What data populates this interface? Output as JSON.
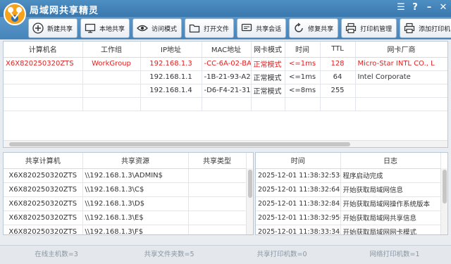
{
  "app": {
    "title": "局域网共享精灵"
  },
  "toolbar": {
    "buttons": [
      {
        "label": "新建共享",
        "icon": "plus-icon"
      },
      {
        "label": "本地共享",
        "icon": "monitor-icon"
      },
      {
        "label": "访问模式",
        "icon": "eye-icon"
      },
      {
        "label": "打开文件",
        "icon": "folder-icon"
      },
      {
        "label": "共享会话",
        "icon": "chat-icon"
      },
      {
        "label": "修复共享",
        "icon": "refresh-icon"
      },
      {
        "label": "打印机管理",
        "icon": "printer-icon"
      },
      {
        "label": "添加打印机",
        "icon": "printer-add-icon"
      }
    ]
  },
  "hosts": {
    "columns": [
      "计算机名",
      "工作组",
      "IP地址",
      "MAC地址",
      "网卡模式",
      "时间",
      "TTL",
      "网卡厂商"
    ],
    "rows": [
      [
        "X6X820250320ZTS",
        "WorkGroup",
        "192.168.1.3",
        "-CC-6A-02-BA",
        "正常模式",
        "<=1ms",
        "128",
        "Micro-Star INTL CO., L"
      ],
      [
        "",
        "",
        "192.168.1.1",
        "-1B-21-93-A2-",
        "正常模式",
        "<=1ms",
        "64",
        "Intel Corporate"
      ],
      [
        "",
        "",
        "192.168.1.4",
        "-D6-F4-21-31-",
        "正常模式",
        "<=8ms",
        "255",
        ""
      ]
    ]
  },
  "shares": {
    "columns": [
      "共享计算机",
      "共享资源",
      "共享类型"
    ],
    "rows": [
      [
        "X6X820250320ZTS",
        "\\\\192.168.1.3\\ADMIN$",
        ""
      ],
      [
        "X6X820250320ZTS",
        "\\\\192.168.1.3\\C$",
        ""
      ],
      [
        "X6X820250320ZTS",
        "\\\\192.168.1.3\\D$",
        ""
      ],
      [
        "X6X820250320ZTS",
        "\\\\192.168.1.3\\E$",
        ""
      ],
      [
        "X6X820250320ZTS",
        "\\\\192.168.1.3\\F$",
        ""
      ]
    ]
  },
  "logs": {
    "columns": [
      "时间",
      "日志"
    ],
    "rows": [
      [
        "2025-12-01 11:38:32:534",
        "程序启动完成"
      ],
      [
        "2025-12-01 11:38:32:641",
        "开始获取局域网信息"
      ],
      [
        "2025-12-01 11:38:32:842",
        "开始获取局域网操作系统版本"
      ],
      [
        "2025-12-01 11:38:32:950",
        "开始获取局域网共享信息"
      ],
      [
        "2025-12-01 11:38:33:343",
        "开始获取局域网网卡模式"
      ]
    ]
  },
  "status": {
    "online_hosts": "在线主机数=3",
    "shared_folders": "共享文件夹数=5",
    "shared_printers": "共享打印机数=0",
    "network_printers": "网络打印机数=1"
  },
  "colors": {
    "accent": "#3f7fb6",
    "highlight_text": "#dd2222"
  }
}
